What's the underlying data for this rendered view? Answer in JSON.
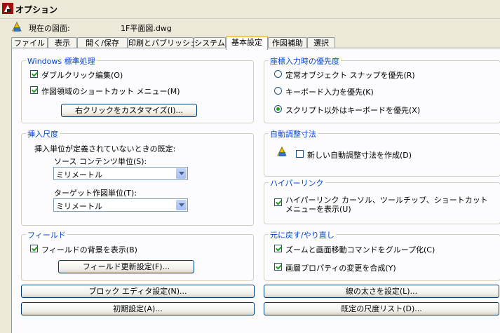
{
  "window": {
    "title": "オプション"
  },
  "drawing": {
    "label": "現在の図面:",
    "value": "1F平面図.dwg"
  },
  "tabs": [
    {
      "label": "ファイル"
    },
    {
      "label": "表示"
    },
    {
      "label": "開く/保存"
    },
    {
      "label": "印刷とパブリッシュ"
    },
    {
      "label": "システム"
    },
    {
      "label": "基本設定"
    },
    {
      "label": "作図補助"
    },
    {
      "label": "選択"
    }
  ],
  "windows_std": {
    "title": "Windows 標準処理",
    "dblclick": {
      "label": "ダブルクリック編集(O)",
      "checked": true
    },
    "shortcut": {
      "label": "作図領域のショートカット メニュー(M)",
      "checked": true
    },
    "customize_btn": "右クリックをカスタマイズ(I)..."
  },
  "insert_scale": {
    "title": "挿入尺度",
    "desc": "挿入単位が定義されていないときの既定:",
    "source_label": "ソース コンテンツ単位(S):",
    "source_value": "ミリメートル",
    "target_label": "ターゲット作図単位(T):",
    "target_value": "ミリメートル"
  },
  "fields": {
    "title": "フィールド",
    "bg": {
      "label": "フィールドの背景を表示(B)",
      "checked": true
    },
    "update_btn": "フィールド更新設定(F)..."
  },
  "coord_priority": {
    "title": "座標入力時の優先度",
    "options": [
      {
        "label": "定常オブジェクト スナップを優先(R)",
        "checked": false
      },
      {
        "label": "キーボード入力を優先(K)",
        "checked": false
      },
      {
        "label": "スクリプト以外はキーボードを優先(X)",
        "checked": true
      }
    ]
  },
  "assoc_dim": {
    "title": "自動調整寸法",
    "new": {
      "label": "新しい自動調整寸法を作成(D)",
      "checked": false
    }
  },
  "hyperlink": {
    "title": "ハイパーリンク",
    "show": {
      "label_line1": "ハイパーリンク カーソル、ツールチップ、ショートカット",
      "label_line2": "メニューを表示(U)",
      "checked": true
    }
  },
  "undo_redo": {
    "title": "元に戻す/やり直し",
    "group_zoom": {
      "label": "ズームと画面移動コマンドをグループ化(C)",
      "checked": true
    },
    "combine_layer": {
      "label": "画層プロパティの変更を合成(Y)",
      "checked": true
    }
  },
  "buttons": {
    "block_editor": "ブロック エディタ設定(N)...",
    "lineweight": "線の太さを設定(L)...",
    "initial": "初期設定(A)...",
    "default_scale": "既定の尺度リスト(D)..."
  },
  "icons": {
    "app": "autocad-app-icon",
    "drawing": "drawing-file-icon",
    "dim": "dimension-icon"
  }
}
